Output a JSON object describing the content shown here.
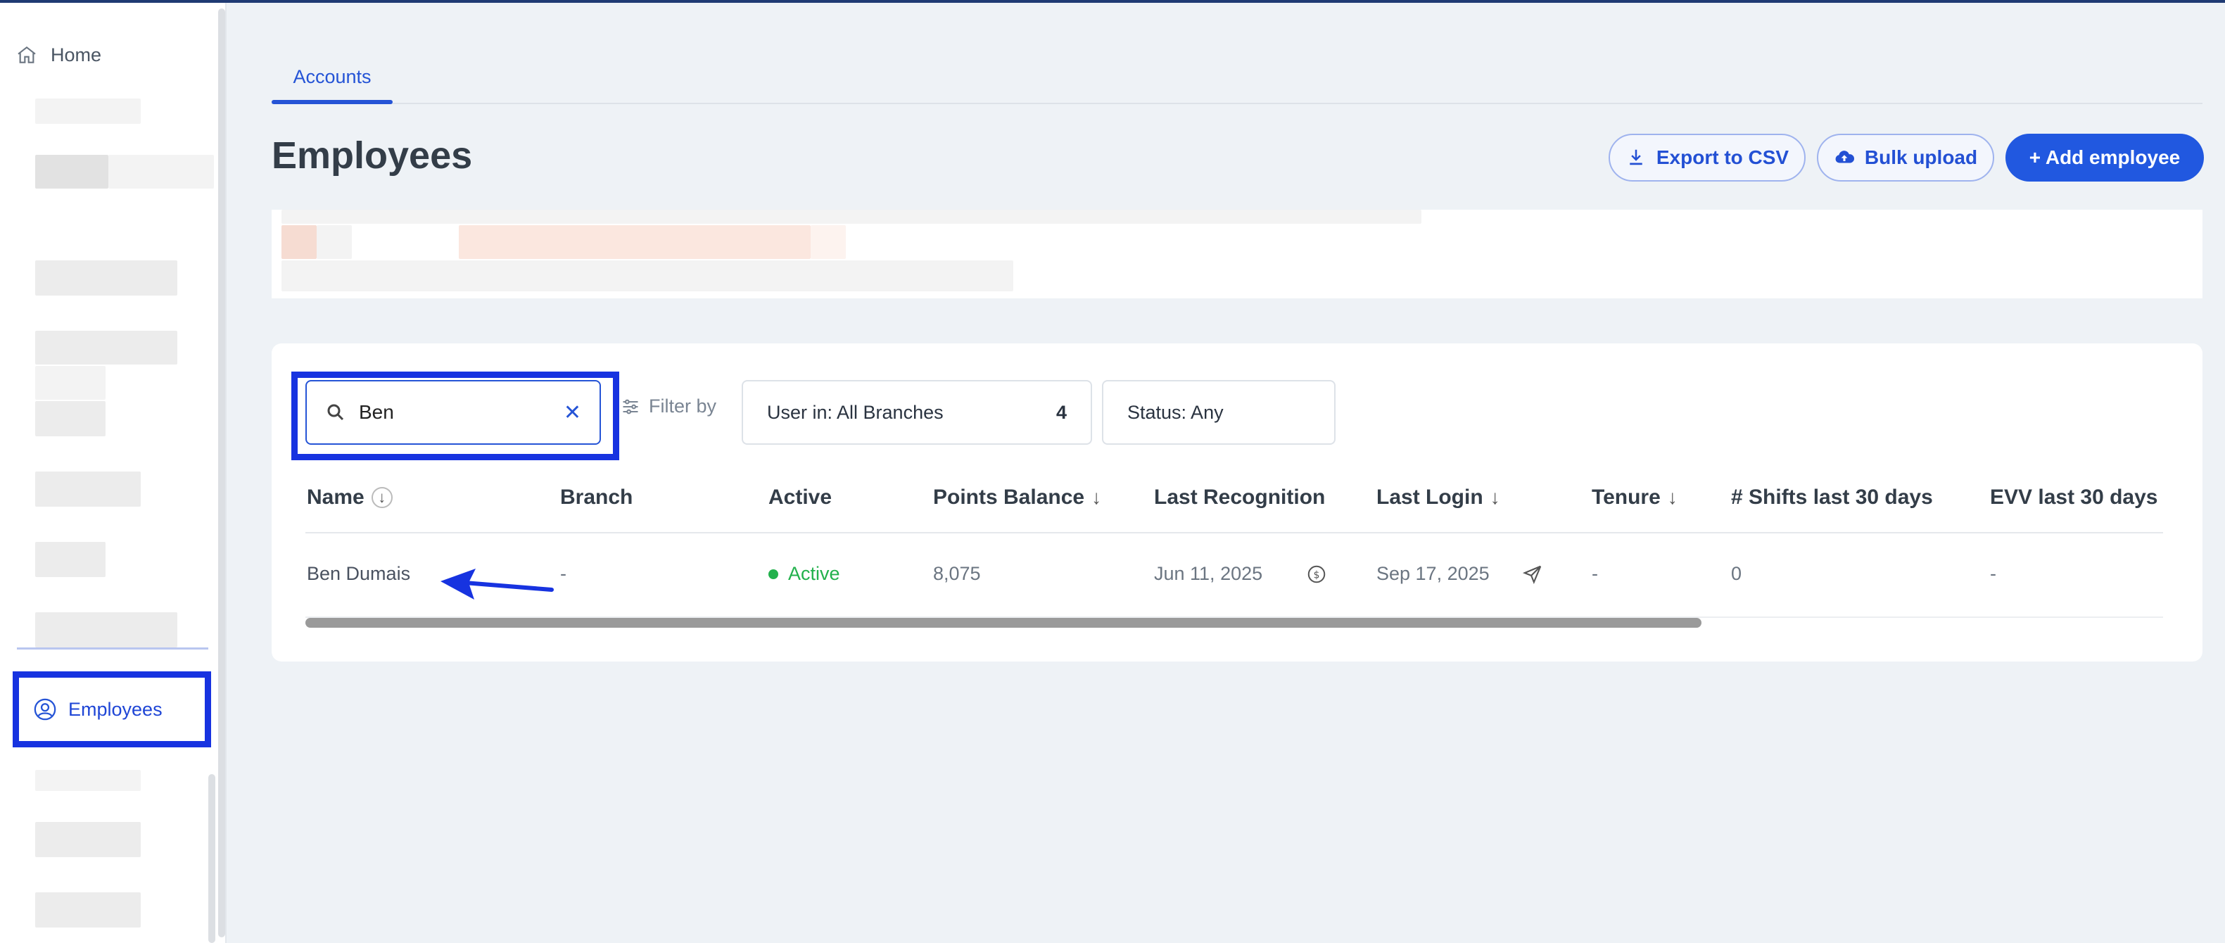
{
  "sidebar": {
    "home_label": "Home",
    "employees_label": "Employees"
  },
  "tabs": [
    {
      "label": "Accounts",
      "active": true
    }
  ],
  "page": {
    "title": "Employees"
  },
  "actions": {
    "export_label": "Export to CSV",
    "bulk_label": "Bulk upload",
    "add_label": "+ Add employee"
  },
  "search": {
    "value": "Ben"
  },
  "filters": {
    "filter_by_label": "Filter by",
    "branches_label": "User in: All Branches",
    "branches_count": "4",
    "status_label": "Status: Any"
  },
  "table": {
    "columns": [
      "Name",
      "Branch",
      "Active",
      "Points Balance",
      "Last Recognition",
      "Last Login",
      "Tenure",
      "# Shifts last 30 days",
      "EVV last 30 days"
    ],
    "rows": [
      {
        "name": "Ben Dumais",
        "branch": "-",
        "active": "Active",
        "points": "8,075",
        "last_recognition": "Jun 11, 2025",
        "last_login": "Sep 17, 2025",
        "tenure": "-",
        "shifts": "0",
        "evv": "-"
      }
    ]
  },
  "colors": {
    "accent": "#2158e0",
    "highlight": "#1733e0",
    "active": "#22b14c",
    "background": "#eef2f6"
  }
}
